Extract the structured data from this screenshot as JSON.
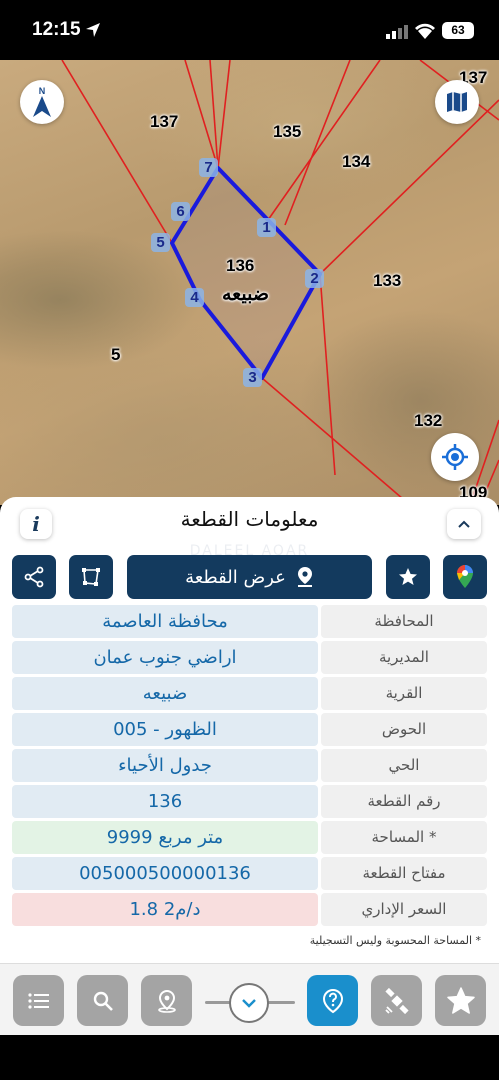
{
  "status_bar": {
    "time": "12:15",
    "battery": "63"
  },
  "map": {
    "parcel_numbers": [
      "137",
      "135",
      "134",
      "136",
      "133",
      "5",
      "132",
      "109",
      "137"
    ],
    "selected_parcel_name": "ضبيعه",
    "vertices": [
      "1",
      "2",
      "3",
      "4",
      "5",
      "6",
      "7"
    ],
    "compass_label": "N"
  },
  "panel": {
    "title": "معلومات القطعة",
    "watermark": "DALEEL AQAR",
    "show_plot_label": "عرض القطعة",
    "rows": [
      {
        "label": "المحافظة",
        "value": "محافظة العاصمة"
      },
      {
        "label": "المديرية",
        "value": "اراضي جنوب عمان"
      },
      {
        "label": "القرية",
        "value": "ضبيعه"
      },
      {
        "label": "الحوض",
        "value": "الظهور - 005"
      },
      {
        "label": "الحي",
        "value": "جدول الأحياء"
      },
      {
        "label": "رقم القطعة",
        "value": "136"
      },
      {
        "label": "المساحة *",
        "value": "9999   متر مربع"
      },
      {
        "label": "مفتاح القطعة",
        "value": "005000500000136"
      },
      {
        "label": "السعر الإداري",
        "value": "1.8 د/م2"
      }
    ],
    "footnote": "* المساحة المحسوبة وليس التسجيلية"
  },
  "icons": [
    "location-arrow-icon",
    "signal-icon",
    "wifi-icon",
    "compass-icon",
    "map-layers-icon",
    "locate-icon",
    "info-icon",
    "chevron-up-icon",
    "share-icon",
    "polygon-icon",
    "map-pin-icon",
    "star-icon",
    "google-maps-icon",
    "list-icon",
    "search-icon",
    "location-target-icon",
    "chevron-down-icon",
    "help-icon",
    "satellite-icon",
    "favorites-star-icon"
  ],
  "colors": {
    "navy": "#133a5e",
    "accent_blue": "#1a8fcc",
    "value_text": "#1568a8",
    "parcel_outline": "#1a1adc",
    "boundary_red": "#e02020"
  }
}
